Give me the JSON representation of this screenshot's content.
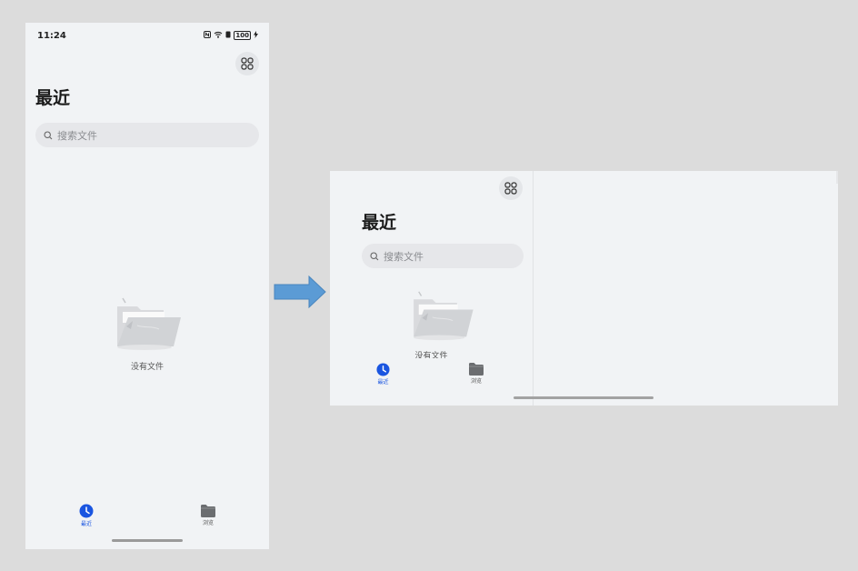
{
  "colors": {
    "accent": "#1a55e0",
    "background": "#f1f3f5",
    "arrow": "#5b9bd5"
  },
  "portrait": {
    "status_time": "11:24",
    "status_icons": [
      "nfc-icon",
      "wifi-icon",
      "signal-icon"
    ],
    "battery": "100",
    "title": "最近",
    "search_placeholder": "搜索文件",
    "empty_text": "没有文件",
    "nav": [
      {
        "label": "最近",
        "icon": "clock-icon",
        "active": true
      },
      {
        "label": "浏览",
        "icon": "folder-icon",
        "active": false
      }
    ]
  },
  "landscape": {
    "title": "最近",
    "search_placeholder": "搜索文件",
    "empty_text": "没有文件",
    "nav": [
      {
        "label": "最近",
        "icon": "clock-icon",
        "active": true
      },
      {
        "label": "浏览",
        "icon": "folder-icon",
        "active": false
      }
    ]
  }
}
